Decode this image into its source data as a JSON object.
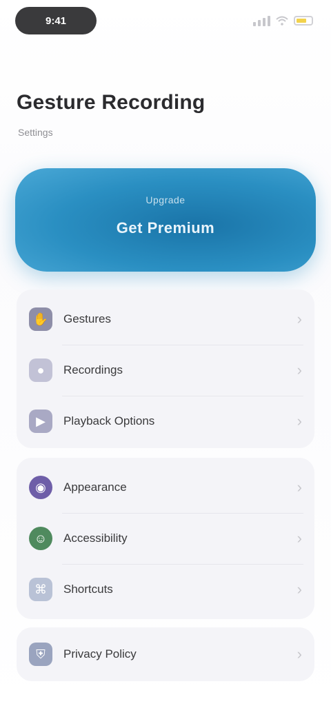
{
  "status_bar": {
    "time": "9:41"
  },
  "header": {
    "title": "Gesture Recording",
    "subtitle": "Settings"
  },
  "promo": {
    "title": "Upgrade",
    "cta": "Get Premium"
  },
  "groups": [
    {
      "items": [
        {
          "label": "Gestures",
          "icon": "hand-icon",
          "color": "#8e8ea8"
        },
        {
          "label": "Recordings",
          "icon": "record-icon",
          "color": "#c2c2d6"
        },
        {
          "label": "Playback Options",
          "icon": "play-icon",
          "color": "#a9a9c4"
        }
      ]
    },
    {
      "items": [
        {
          "label": "Appearance",
          "icon": "palette-icon",
          "color": "#6e5ea8"
        },
        {
          "label": "Accessibility",
          "icon": "accessibility-icon",
          "color": "#4f8a5e"
        },
        {
          "label": "Shortcuts",
          "icon": "shortcut-icon",
          "color": "#b9c2d6"
        }
      ]
    },
    {
      "items": [
        {
          "label": "Privacy Policy",
          "icon": "shield-icon",
          "color": "#9aa4bf"
        }
      ]
    }
  ]
}
